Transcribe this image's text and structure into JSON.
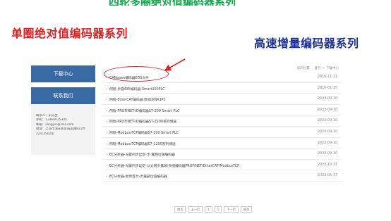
{
  "banner_top": "四轮多圈绝对值编码器系列",
  "headline_left": "单圈绝对值编码器系列",
  "headline_right": "高速增量编码器系列",
  "sidebar": {
    "download_label": "下载中心",
    "contact_label": "联系我们",
    "contact_lines": [
      "联系人：宋先生",
      "手机：13366035345",
      "邮箱：songylc@163.com",
      "地址：上海市浦东新区南美路821弄",
      "22号3502室"
    ]
  },
  "breadcrumb": {
    "prefix": "您的位置：",
    "home": "首页",
    "sep": ">",
    "current": "下载中心"
  },
  "downloads": [
    {
      "title": "CANopen编码器EDS文件",
      "date": "2016-11-31"
    },
    {
      "title": "例程-步露485编码器 Smart200PLC",
      "date": "2016-01-15"
    },
    {
      "title": "例程-EtherCAT编码器 欧姆龙NX1P2",
      "date": "2023-09-10"
    },
    {
      "title": "例程-PROFINET-IO编码器S7-200 Smart PLC",
      "date": "2023-09-10"
    },
    {
      "title": "例程-PROFINET-IO编码器S7-1200系列博途",
      "date": "2023-09-10"
    },
    {
      "title": "例程-Modbus-TCP编码器S7-200 Smart PLC",
      "date": "2023-09-10"
    },
    {
      "title": "例程-Modbus-TCP编码器S7-1200系列博途",
      "date": "2023-09-10"
    },
    {
      "title": "EC分析器-光藏同步动定-步 露档位值编码器",
      "date": "2023-09-10"
    },
    {
      "title": "EC分析器-光藏同步动定-以太网步露单/多圈编码器PROFINET/EtherCAT/ModbusTCP",
      "date": "2023-10-11"
    },
    {
      "title": "EC分析器-星球首为-步露部位值编码器",
      "date": "2023-05-17"
    }
  ],
  "pager": {
    "first": "首页",
    "prev": "上一页",
    "page1": "1",
    "page2": "1",
    "next": "下一页",
    "last": "尾页"
  },
  "colors": {
    "sidebar_blue": "#3a6aa4",
    "headline_red": "#e01e1e",
    "headline_blue": "#1a2f9c",
    "banner_green": "#11a84a"
  }
}
